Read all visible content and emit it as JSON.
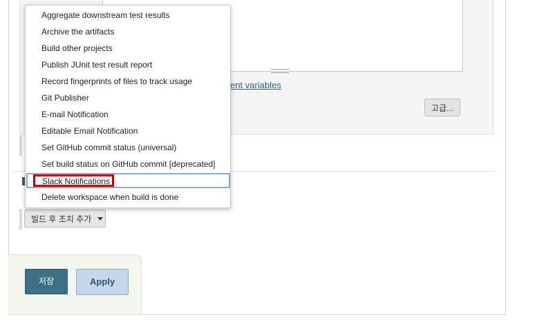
{
  "page": {
    "env_link_text": "ent variables",
    "advanced_label": "고급...",
    "post_build_label": "빌드 후 조치 추가",
    "save_label": "저장",
    "apply_label": "Apply"
  },
  "dropdown": {
    "selected": "Slack Notifications",
    "items": [
      {
        "label": "Aggregate downstream test results"
      },
      {
        "label": "Archive the artifacts"
      },
      {
        "label": "Build other projects"
      },
      {
        "label": "Publish JUnit test result report"
      },
      {
        "label": "Record fingerprints of files to track usage"
      },
      {
        "label": "Git Publisher"
      },
      {
        "label": "E-mail Notification"
      },
      {
        "label": "Editable Email Notification"
      },
      {
        "label": "Set GitHub commit status (universal)"
      },
      {
        "label": "Set build status on GitHub commit [deprecated]"
      },
      {
        "label": "Slack Notifications"
      },
      {
        "label": "Delete workspace when build is done"
      }
    ]
  },
  "colors": {
    "highlight": "#c60000",
    "selection_border": "#79aee8",
    "save_bg": "#3d6f86",
    "apply_bg": "#c6d7ea",
    "link": "#2360a5"
  }
}
